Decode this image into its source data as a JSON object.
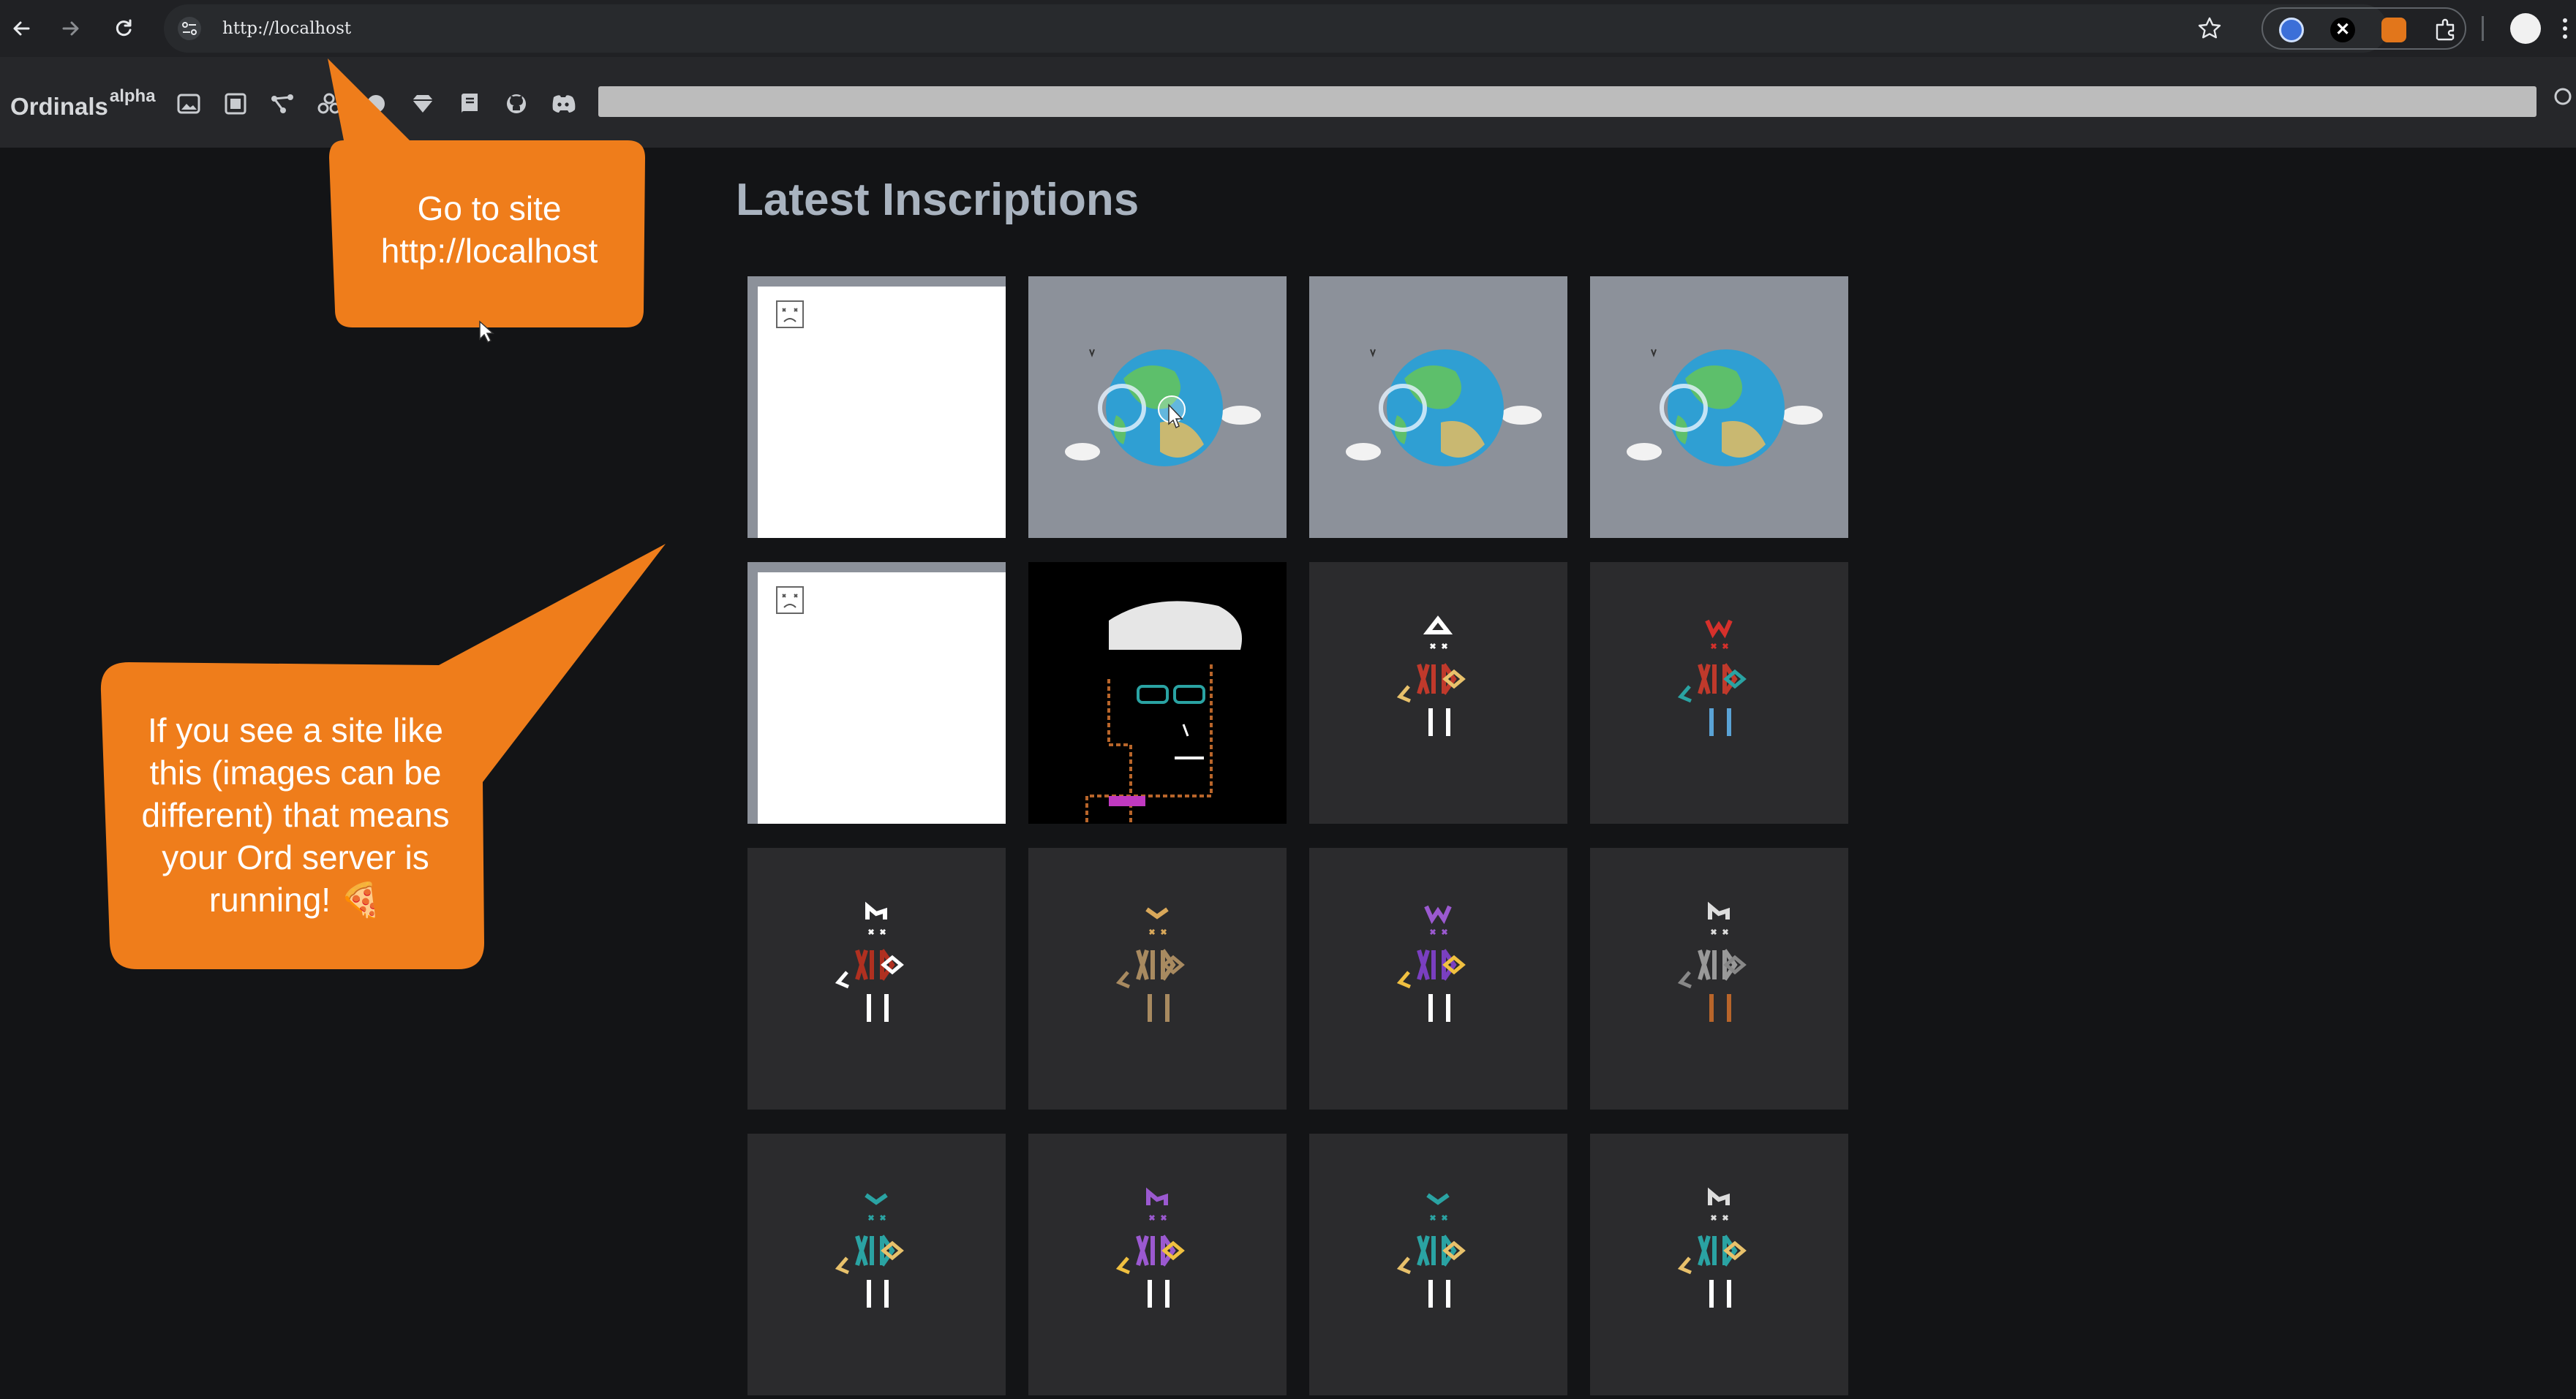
{
  "browser": {
    "url": "http://localhost"
  },
  "header": {
    "brand": "Ordinals",
    "brand_sup": "alpha",
    "nav_icons": [
      "images-icon",
      "block-icon",
      "network-icon",
      "collections-icon",
      "dot-icon",
      "gem-icon",
      "book-icon",
      "github-icon",
      "discord-icon"
    ]
  },
  "main": {
    "title": "Latest Inscriptions",
    "tiles": [
      {
        "kind": "broken"
      },
      {
        "kind": "earth",
        "cursor": true
      },
      {
        "kind": "earth"
      },
      {
        "kind": "earth"
      },
      {
        "kind": "broken"
      },
      {
        "kind": "face"
      },
      {
        "kind": "rune",
        "top": "#ffffff",
        "body": "#c0392b",
        "accent": "#e8c16b",
        "legs": "#ffffff",
        "hat": "tri"
      },
      {
        "kind": "rune",
        "top": "#d6302b",
        "body": "#c0392b",
        "accent": "#2aa3a3",
        "legs": "#5aa3d6",
        "hat": "w"
      },
      {
        "kind": "rune",
        "top": "#ffffff",
        "body": "#b03020",
        "accent": "#ffffff",
        "legs": "#ffffff",
        "hat": "crown"
      },
      {
        "kind": "rune",
        "top": "#d9a85a",
        "body": "#a88a60",
        "accent": "#a88a60",
        "legs": "#a88a60",
        "hat": "chev"
      },
      {
        "kind": "rune",
        "top": "#9b59d0",
        "body": "#7a3fc0",
        "accent": "#f0c040",
        "legs": "#ffffff",
        "hat": "w"
      },
      {
        "kind": "rune",
        "top": "#dddddd",
        "body": "#999999",
        "accent": "#888888",
        "legs": "#b8652a",
        "hat": "crown"
      },
      {
        "kind": "rune",
        "top": "#2aa3a3",
        "body": "#2aa3a3",
        "accent": "#e8c16b",
        "legs": "#ffffff",
        "hat": "chev"
      },
      {
        "kind": "rune",
        "top": "#9b59d0",
        "body": "#9b59d0",
        "accent": "#f0c040",
        "legs": "#ffffff",
        "hat": "crown"
      },
      {
        "kind": "rune",
        "top": "#2aa3a3",
        "body": "#2aa3a3",
        "accent": "#e8c16b",
        "legs": "#ffffff",
        "hat": "chev"
      },
      {
        "kind": "rune",
        "top": "#dddddd",
        "body": "#2aa3a3",
        "accent": "#e8c16b",
        "legs": "#ffffff",
        "hat": "crown"
      }
    ]
  },
  "annotations": {
    "top_callout": "Go to site http://localhost",
    "side_callout": "If you see a site like this (images can be different) that means your Ord server is running! 🍕"
  },
  "colors": {
    "callout": "#ef7d1b",
    "title": "#a9b3bf"
  }
}
